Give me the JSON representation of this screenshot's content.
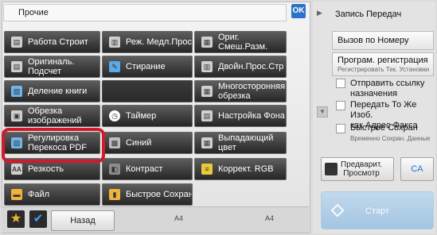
{
  "header": {
    "title": "Прочие",
    "ok_label": "OK"
  },
  "buttons": {
    "rabota_stroit": "Работа Строит",
    "rezh_medl": "Реж. Медл.Прос",
    "orig_smesh_1": "Ориг.",
    "orig_smesh_2": "Смеш.Разм.",
    "original_1": "Оригиналь.",
    "original_2": "Подсчет",
    "stiranie": "Стирание",
    "dvoin": "Двойн.Прос.Стр",
    "delenie": "Деление книги",
    "mnogostor_1": "Многосторонняя",
    "mnogostor_2": "обрезка",
    "obrezka_1": "Обрезка",
    "obrezka_2": "изображений",
    "taimer": "Таймер",
    "nastroika": "Настройка Фона",
    "regul_1": "Регулировка",
    "regul_2": "Перекоса PDF",
    "sinii": "Синий",
    "vypad_1": "Выпадающий",
    "vypad_2": "цвет",
    "rezkost": "Резкость",
    "kontrast": "Контраст",
    "korrekt": "Коррект. RGB",
    "fail": "Файл",
    "bystroe": "Быстрое Сохран"
  },
  "bottom": {
    "back_label": "Назад",
    "paper_left": "A4",
    "paper_right": "A4"
  },
  "right": {
    "title": "Запись Передач",
    "item1": "Вызов по Номеру Поиска",
    "item2_main": "Програм. регистрация",
    "item2_sub": "Регистрировать Тек. Установки",
    "chk1_1": "Отправить ссылку",
    "chk1_2": "назначения",
    "chk2_1": "Передать То Же Изоб.",
    "chk2_2": "как Адрес Факса",
    "chk3_main": "Быстрое Сохран",
    "chk3_sub": "Временно Сохран. Данные",
    "preview_1": "Предварит.",
    "preview_2": "Просмотр",
    "ca_label": "CA",
    "start_label": "Старт"
  },
  "colors": {
    "highlight": "#d01b2a",
    "ok": "#2b73c8",
    "start": "#98c0e2"
  },
  "icons": [
    "doc-icon",
    "slow-scan-icon",
    "mixed-size-icon",
    "count-icon",
    "erase-icon",
    "dual-page-icon",
    "book-divide-icon",
    "multi-crop-icon",
    "image-crop-icon",
    "timer-icon",
    "background-icon",
    "skew-icon",
    "blue-icon",
    "dropout-icon",
    "sharpness-icon",
    "contrast-icon",
    "rgb-icon",
    "file-icon",
    "quick-save-icon",
    "star-icon",
    "check-icon",
    "preview-icon",
    "start-icon"
  ]
}
